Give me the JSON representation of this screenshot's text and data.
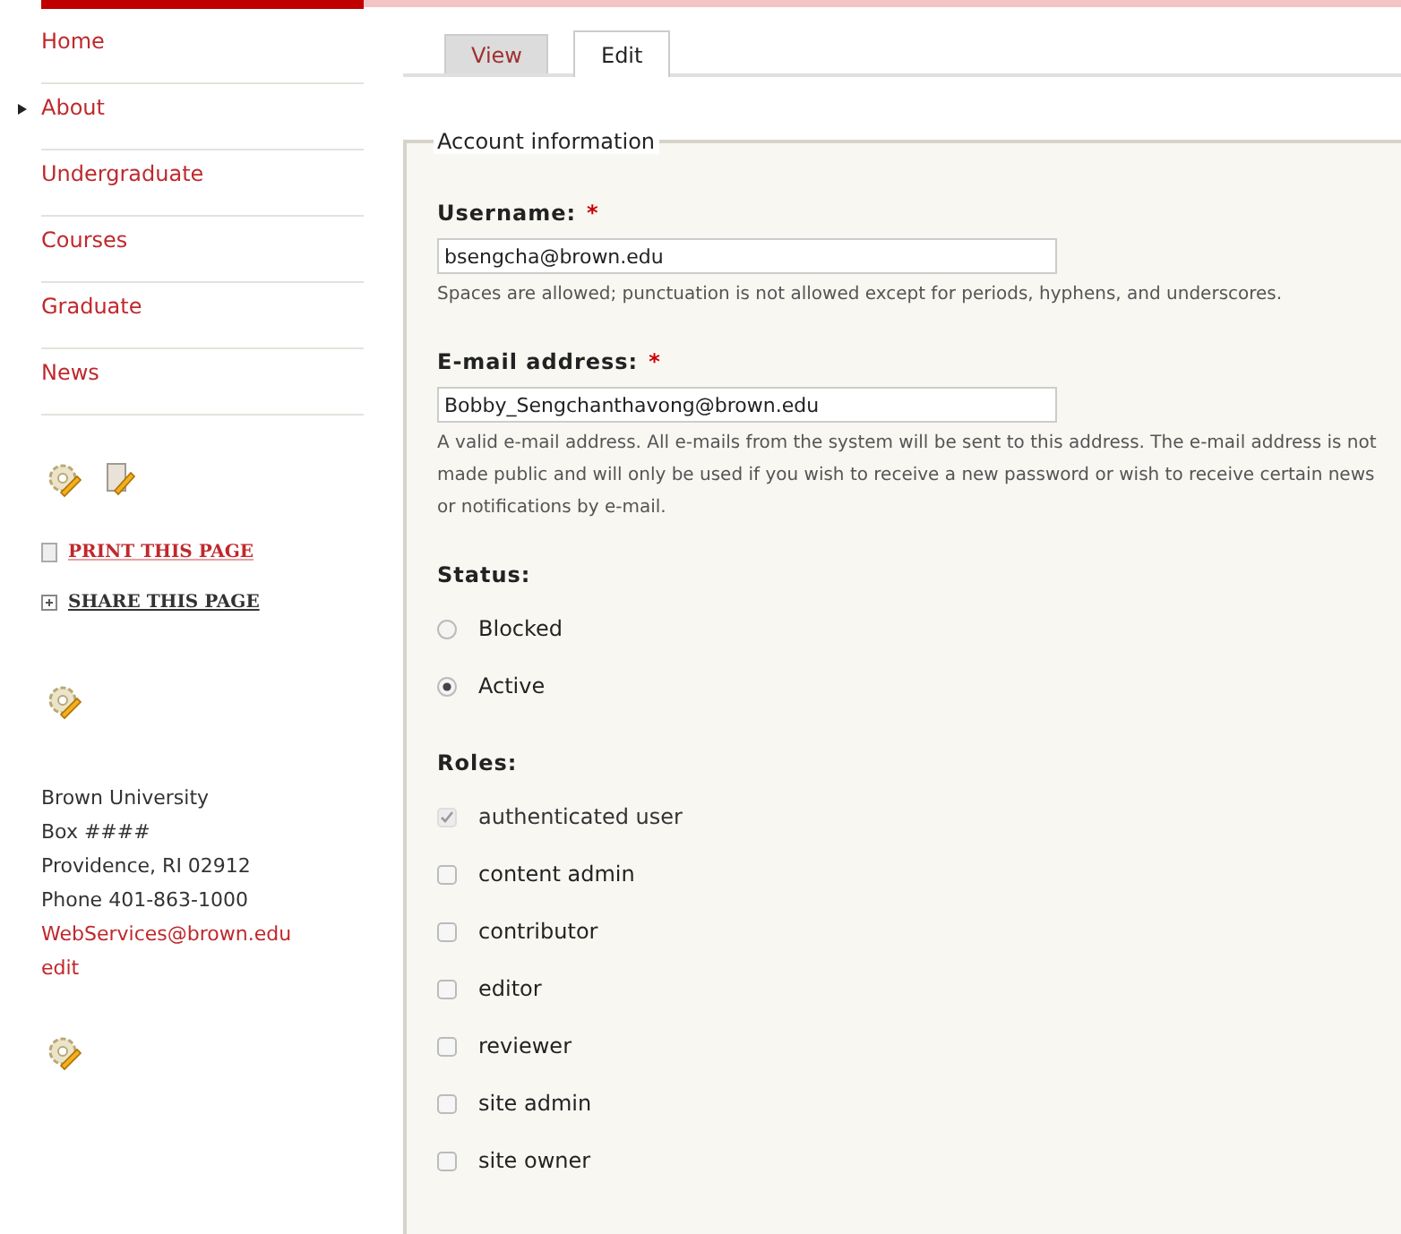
{
  "sidebar": {
    "nav": [
      {
        "label": "Home",
        "selected": false
      },
      {
        "label": "About",
        "selected": true
      },
      {
        "label": "Undergraduate",
        "selected": false
      },
      {
        "label": "Courses",
        "selected": false
      },
      {
        "label": "Graduate",
        "selected": false
      },
      {
        "label": "News",
        "selected": false
      }
    ],
    "page_actions": [
      {
        "label": "PRINT THIS PAGE",
        "kind": "print"
      },
      {
        "label": "SHARE THIS PAGE",
        "kind": "share"
      }
    ],
    "address": [
      "Brown University",
      "Box ####",
      "Providence, RI 02912",
      "Phone 401-863-1000"
    ],
    "email_link": "WebServices@brown.edu",
    "edit_link": "edit"
  },
  "tabs": [
    {
      "label": "View",
      "selected": false
    },
    {
      "label": "Edit",
      "selected": true
    }
  ],
  "fieldset": {
    "legend": "Account information",
    "username": {
      "label": "Username:",
      "required_mark": "*",
      "value": "bsengcha@brown.edu",
      "help": "Spaces are allowed; punctuation is not allowed except for periods, hyphens, and underscores."
    },
    "email": {
      "label": "E-mail address:",
      "required_mark": "*",
      "value": "Bobby_Sengchanthavong@brown.edu",
      "help": "A valid e-mail address. All e-mails from the system will be sent to this address. The e-mail address is not made public and will only be used if you wish to receive a new password or wish to receive certain news or notifications by e-mail."
    },
    "status": {
      "label": "Status:",
      "options": [
        {
          "label": "Blocked",
          "selected": false
        },
        {
          "label": "Active",
          "selected": true
        }
      ]
    },
    "roles": {
      "label": "Roles:",
      "options": [
        {
          "label": "authenticated user",
          "checked": true,
          "disabled": true
        },
        {
          "label": "content admin",
          "checked": false,
          "disabled": false
        },
        {
          "label": "contributor",
          "checked": false,
          "disabled": false
        },
        {
          "label": "editor",
          "checked": false,
          "disabled": false
        },
        {
          "label": "reviewer",
          "checked": false,
          "disabled": false
        },
        {
          "label": "site admin",
          "checked": false,
          "disabled": false
        },
        {
          "label": "site owner",
          "checked": false,
          "disabled": false
        }
      ]
    }
  }
}
